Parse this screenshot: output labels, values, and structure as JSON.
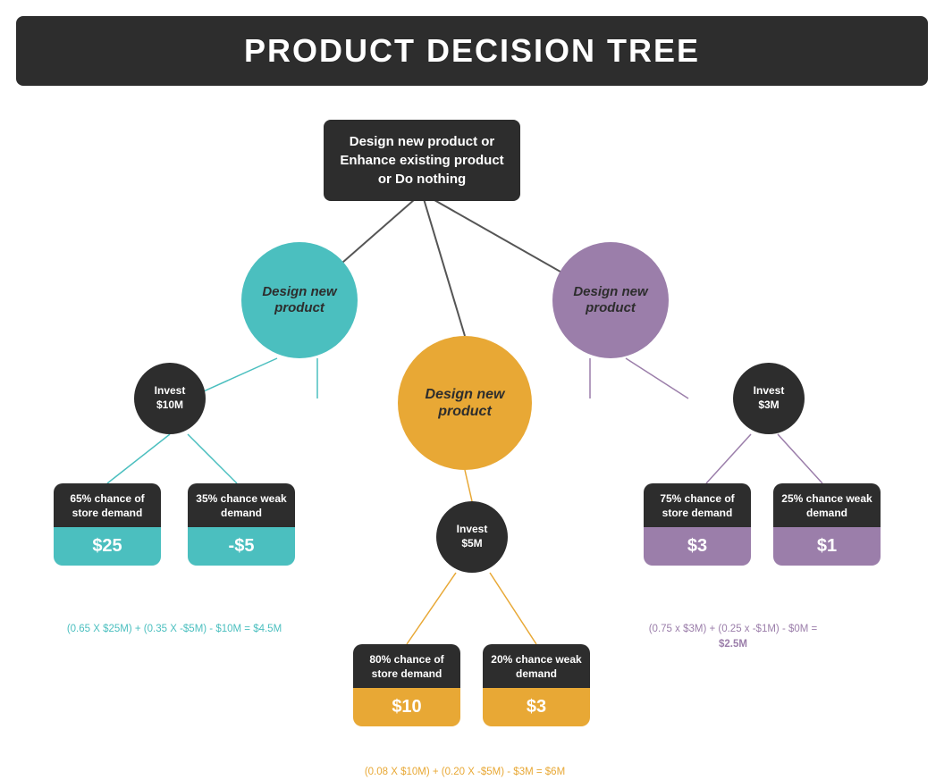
{
  "header": {
    "title": "PRODUCT DECISION TREE"
  },
  "root": {
    "label": "Design new product or Enhance existing product or Do nothing"
  },
  "circles": {
    "teal": {
      "label": "Design new product"
    },
    "purple": {
      "label": "Design new product"
    },
    "orange": {
      "label": "Design new product"
    }
  },
  "invest": {
    "ten": {
      "label": "Invest\n$10M"
    },
    "five": {
      "label": "Invest\n$5M"
    },
    "three": {
      "label": "Invest\n$3M"
    }
  },
  "cards": {
    "c65_top": "65% chance of store demand",
    "c65_val": "$25",
    "c35_top": "35% chance weak demand",
    "c35_val": "-$5",
    "c80_top": "80% chance of store demand",
    "c80_val": "$10",
    "c20_top": "20% chance weak demand",
    "c20_val": "$3",
    "c75_top": "75% chance of store demand",
    "c75_val": "$3",
    "c25_top": "25% chance weak demand",
    "c25_val": "$1"
  },
  "formulas": {
    "teal": "(0.65 X $25M) + (0.35 X -$5M) - $10M = $4.5M",
    "orange": "(0.08 X $10M) + (0.20 X -$5M) - $3M = $6M",
    "purple_line1": "(0.75 x $3M) + (0.25 x -$1M) - $0M =",
    "purple_line2": "$2.5M"
  }
}
